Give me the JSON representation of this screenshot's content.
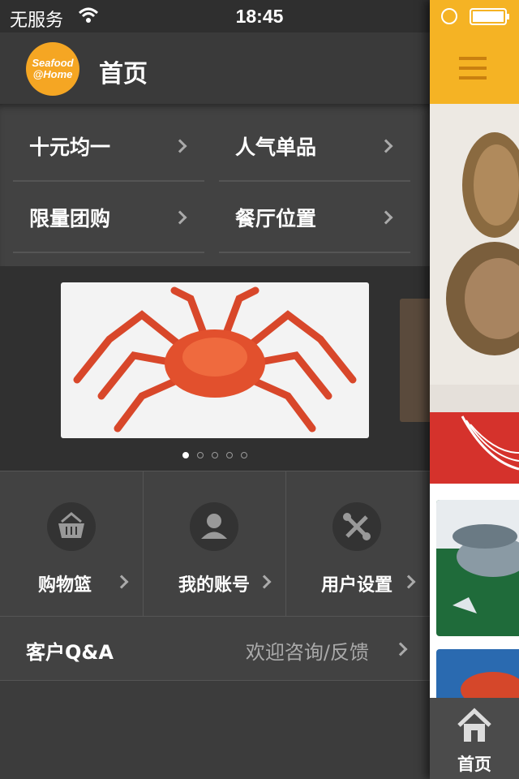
{
  "status_bar": {
    "carrier": "无服务",
    "time": "18:45"
  },
  "header": {
    "logo_line1": "Seafood",
    "logo_line2": "@Home",
    "title": "首页"
  },
  "quick_links": [
    {
      "label": "十元均一"
    },
    {
      "label": "人气单品"
    },
    {
      "label": "限量团购"
    },
    {
      "label": "餐厅位置"
    }
  ],
  "carousel": {
    "page_count": 5,
    "active_index": 0
  },
  "shortcuts": [
    {
      "label": "购物篮",
      "icon": "basket-icon"
    },
    {
      "label": "我的账号",
      "icon": "user-icon"
    },
    {
      "label": "用户设置",
      "icon": "tools-icon"
    }
  ],
  "support_row": {
    "left": "客户Q&A",
    "right": "欢迎咨询/反馈"
  },
  "right_panel": {
    "tab_label": "首页",
    "accent": "#f5b324"
  },
  "colors": {
    "drawer_bg": "#3c3c3c",
    "accent": "#f5a623"
  }
}
